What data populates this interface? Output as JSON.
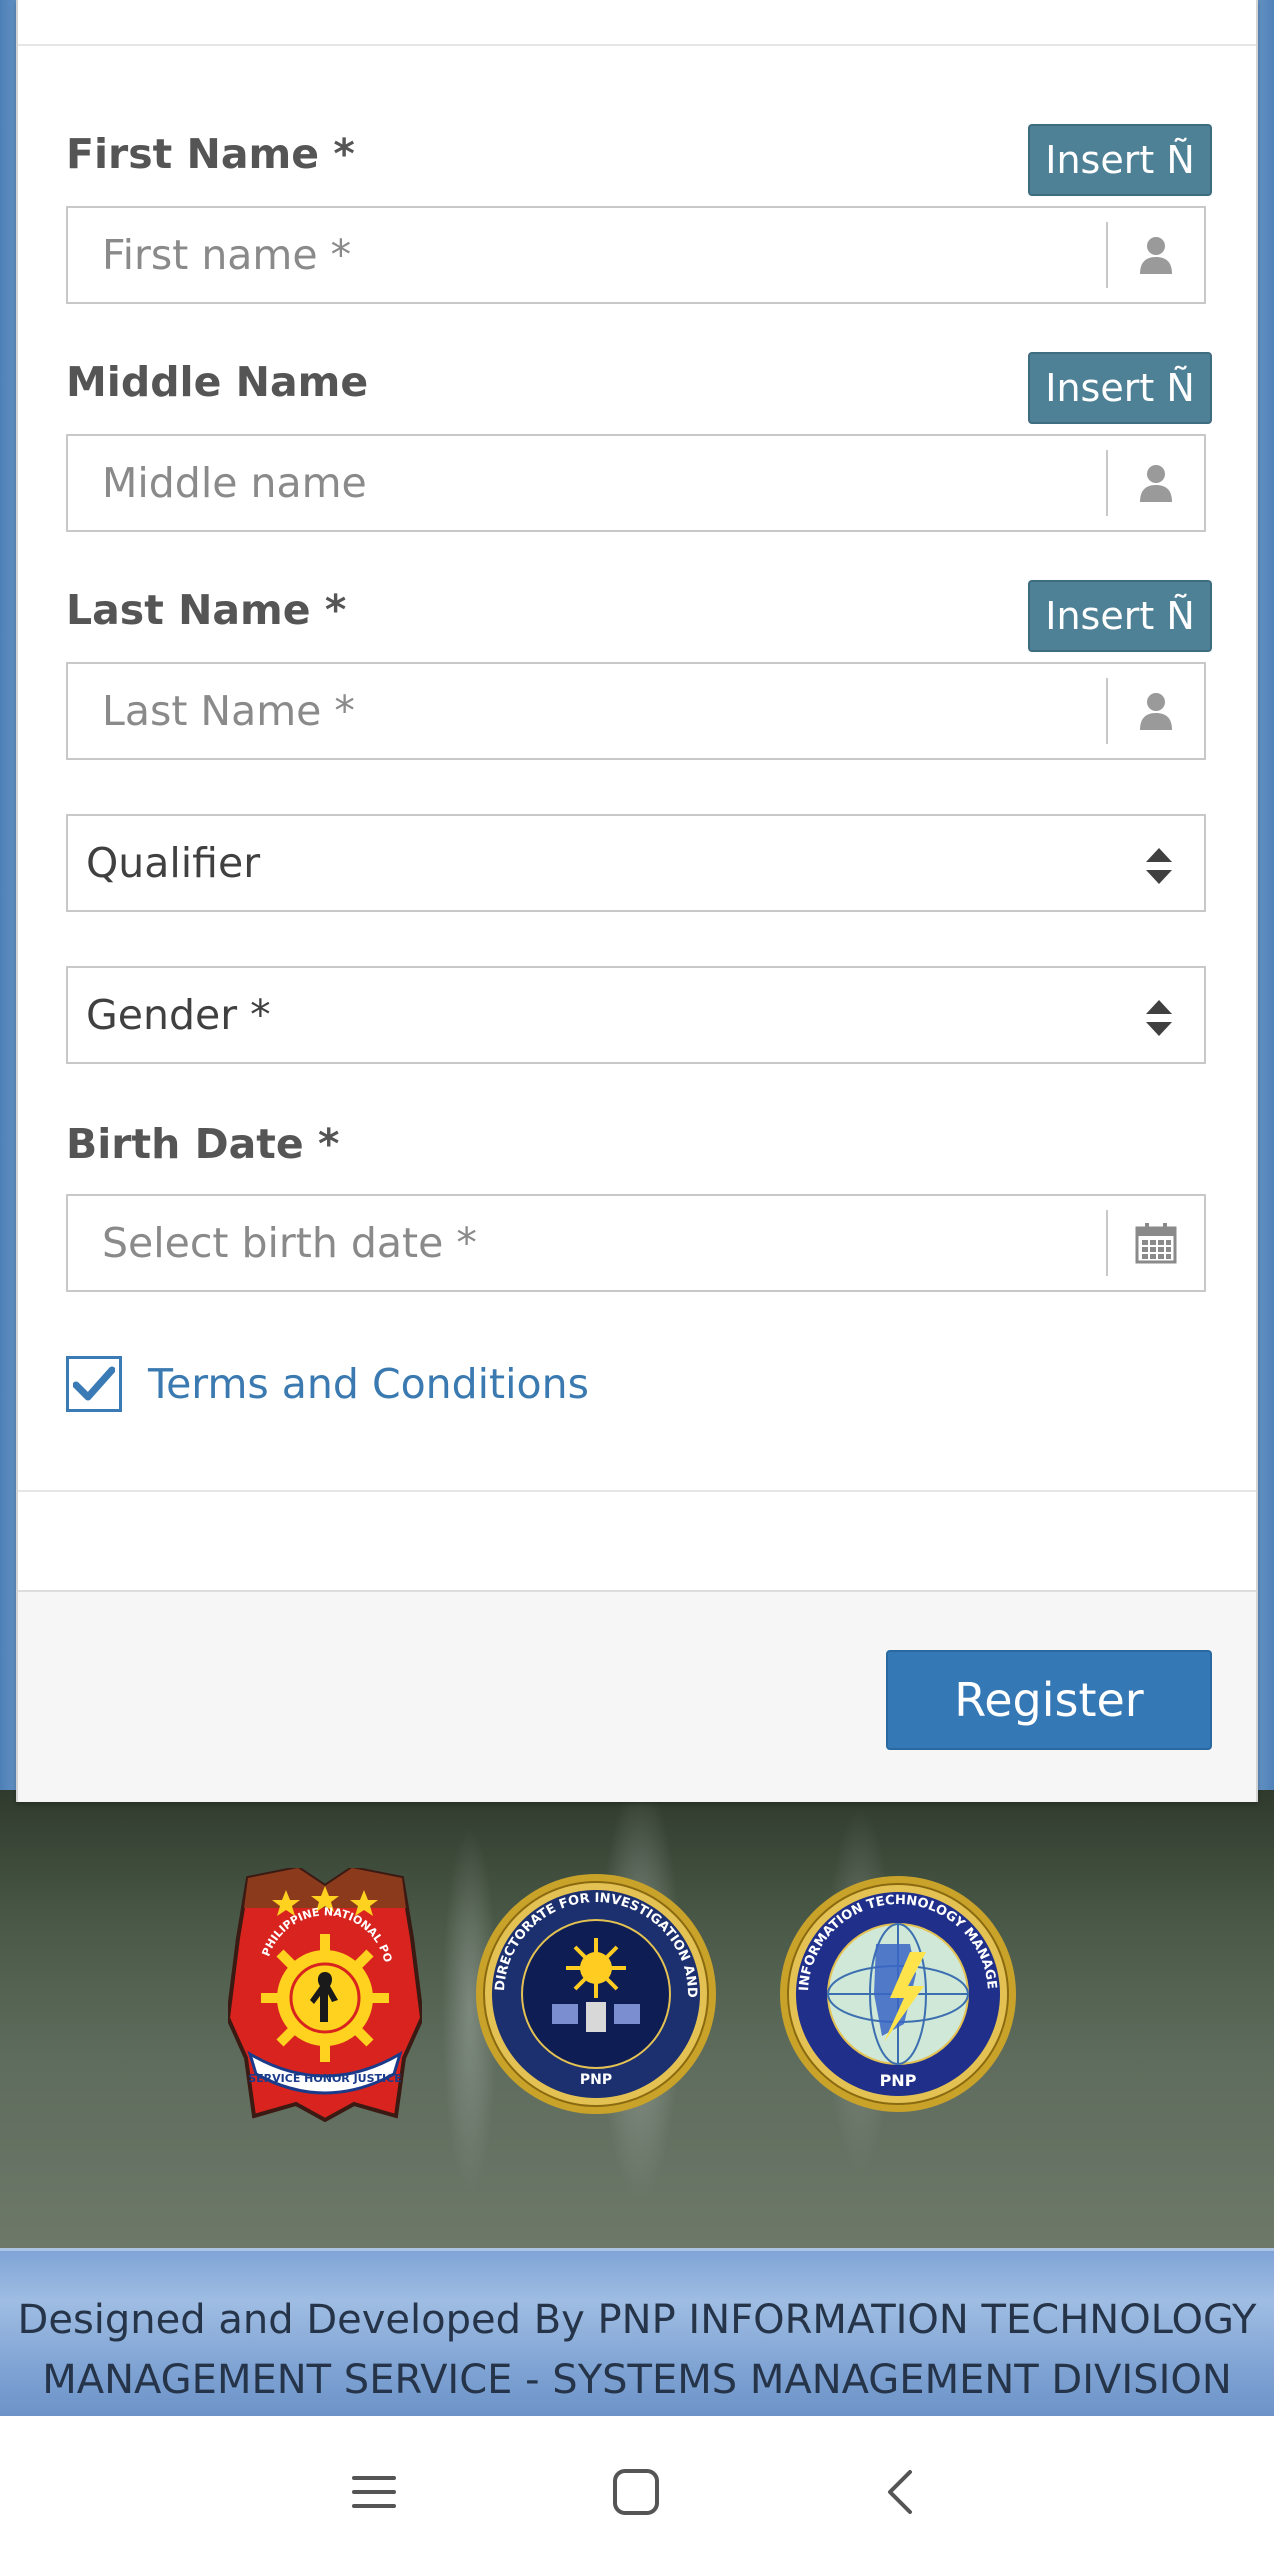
{
  "form": {
    "first_name": {
      "label": "First Name *",
      "insert": "Insert Ñ",
      "placeholder": "First name *",
      "icon": "user-icon"
    },
    "middle_name": {
      "label": "Middle Name",
      "insert": "Insert Ñ",
      "placeholder": "Middle name",
      "icon": "user-icon"
    },
    "last_name": {
      "label": "Last Name *",
      "insert": "Insert Ñ",
      "placeholder": "Last Name *",
      "icon": "user-icon"
    },
    "qualifier": {
      "value": "Qualifier"
    },
    "gender": {
      "value": "Gender *"
    },
    "birth_date": {
      "label": "Birth Date *",
      "placeholder": "Select birth date *",
      "icon": "calendar-icon"
    },
    "terms": {
      "label": "Terms and Conditions",
      "checked": true
    },
    "register_label": "Register"
  },
  "footer": {
    "line1": "Designed and Developed By PNP INFORMATION TECHNOLOGY",
    "line2": "MANAGEMENT SERVICE - SYSTEMS MANAGEMENT DIVISION"
  },
  "logos": {
    "pnp": {
      "top": "PHILIPPINE NATIONAL POLICE",
      "ribbon": "SERVICE HONOR JUSTICE"
    },
    "didm": {
      "ring": "DIRECTORATE FOR INVESTIGATION AND DETECTIVE MANAGEMENT",
      "bottom": "PNP"
    },
    "itms": {
      "ring": "INFORMATION TECHNOLOGY MANAGEMENT SERVICE",
      "bottom": "PNP"
    }
  },
  "colors": {
    "insert_button": "#4e8196",
    "register_button": "#3478b6",
    "link": "#3a7ab0"
  },
  "navbar": {
    "icons": [
      "recent-apps-icon",
      "home-icon",
      "back-icon"
    ]
  }
}
